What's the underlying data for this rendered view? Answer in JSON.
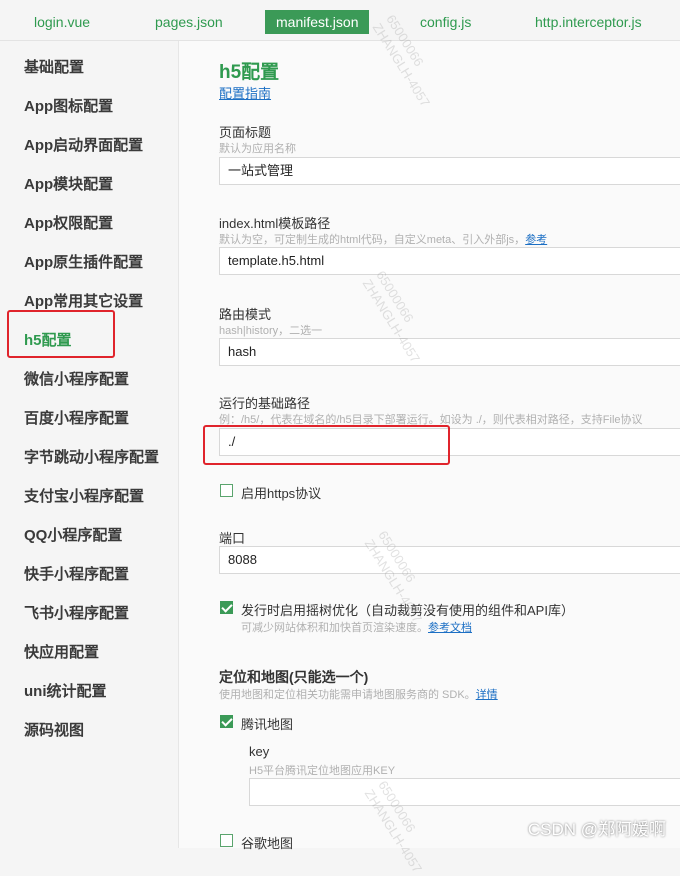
{
  "tabs": [
    {
      "label": "login.vue",
      "active": false
    },
    {
      "label": "pages.json",
      "active": false
    },
    {
      "label": "manifest.json",
      "active": true
    },
    {
      "label": "config.js",
      "active": false
    },
    {
      "label": "http.interceptor.js",
      "active": false
    }
  ],
  "sidebar": {
    "items": [
      {
        "label": "基础配置"
      },
      {
        "label": "App图标配置"
      },
      {
        "label": "App启动界面配置"
      },
      {
        "label": "App模块配置"
      },
      {
        "label": "App权限配置"
      },
      {
        "label": "App原生插件配置"
      },
      {
        "label": "App常用其它设置"
      },
      {
        "label": "h5配置",
        "active": true
      },
      {
        "label": "微信小程序配置"
      },
      {
        "label": "百度小程序配置"
      },
      {
        "label": "字节跳动小程序配置"
      },
      {
        "label": "支付宝小程序配置"
      },
      {
        "label": "QQ小程序配置"
      },
      {
        "label": "快手小程序配置"
      },
      {
        "label": "飞书小程序配置"
      },
      {
        "label": "快应用配置"
      },
      {
        "label": "uni统计配置"
      },
      {
        "label": "源码视图"
      }
    ]
  },
  "main": {
    "title": "h5配置",
    "guide_link": "配置指南",
    "page_title": {
      "label": "页面标题",
      "hint": "默认为应用名称",
      "value": "一站式管理"
    },
    "template": {
      "label": "index.html模板路径",
      "hint": "默认为空，可定制生成的html代码，自定义meta、引入外部js，",
      "hint_link": "参考",
      "value": "template.h5.html"
    },
    "router": {
      "label": "路由模式",
      "hint": "hash|history，二选一",
      "value": "hash"
    },
    "base_path": {
      "label": "运行的基础路径",
      "hint": "例：/h5/，代表在域名的/h5目录下部署运行。如设为 ./，则代表相对路径，支持File协议",
      "value": "./"
    },
    "https": {
      "label": "启用https协议",
      "checked": false
    },
    "port": {
      "label": "端口",
      "value": "8088"
    },
    "treeshake": {
      "label": "发行时启用摇树优化（自动裁剪没有使用的组件和API库）",
      "checked": true,
      "hint": "可减少网站体积和加快首页渲染速度。",
      "hint_link": "参考文档"
    },
    "map": {
      "title": "定位和地图(只能选一个)",
      "hint": "使用地图和定位相关功能需申请地图服务商的 SDK。",
      "hint_link": "详情",
      "tencent": {
        "label": "腾讯地图",
        "checked": true
      },
      "key": {
        "label": "key",
        "hint": "H5平台腾讯定位地图应用KEY",
        "value": ""
      },
      "google": {
        "label": "谷歌地图",
        "checked": false
      }
    }
  },
  "watermark": {
    "line1": "65000066",
    "line2": "ZHANGLH-4057"
  },
  "credit": "CSDN @郑阿媛啊",
  "colors": {
    "accent": "#3b9a57",
    "highlight": "#e0242c",
    "link": "#1c6fc4"
  }
}
